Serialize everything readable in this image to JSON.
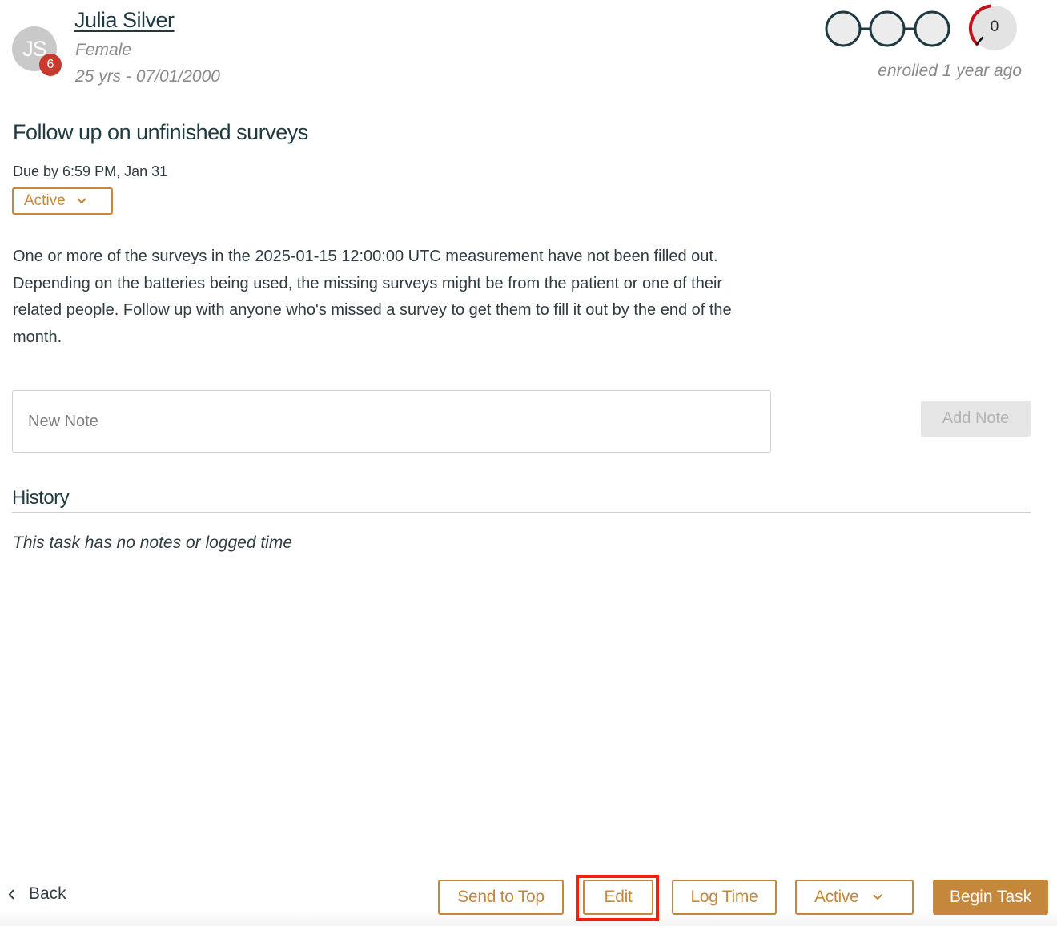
{
  "patient": {
    "initials": "JS",
    "badge_count": "6",
    "name": "Julia Silver",
    "gender": "Female",
    "age_dob": "25 yrs - 07/01/2000",
    "progress_steps": 3,
    "score": "0",
    "enrolled": "enrolled 1 year ago"
  },
  "task": {
    "title": "Follow up on unfinished surveys",
    "due": "Due by 6:59 PM, Jan 31",
    "status": "Active",
    "description": "One or more of the surveys in the 2025-01-15 12:00:00 UTC measurement have not been filled out. Depending on the batteries being used, the missing surveys might be from the patient or one of their related people. Follow up with anyone who's missed a survey to get them to fill it out by the end of the month."
  },
  "notes": {
    "placeholder": "New Note",
    "add_label": "Add Note"
  },
  "history": {
    "title": "History",
    "empty": "This task has no notes or logged time"
  },
  "footer": {
    "back_label": "Back",
    "send_to_top": "Send to Top",
    "edit": "Edit",
    "log_time": "Log Time",
    "status": "Active",
    "begin_task": "Begin Task"
  },
  "colors": {
    "accent": "#c4873b",
    "badge": "#c63a2d",
    "gauge_arc": "#c0141a",
    "highlight": "#ff1a0a"
  }
}
